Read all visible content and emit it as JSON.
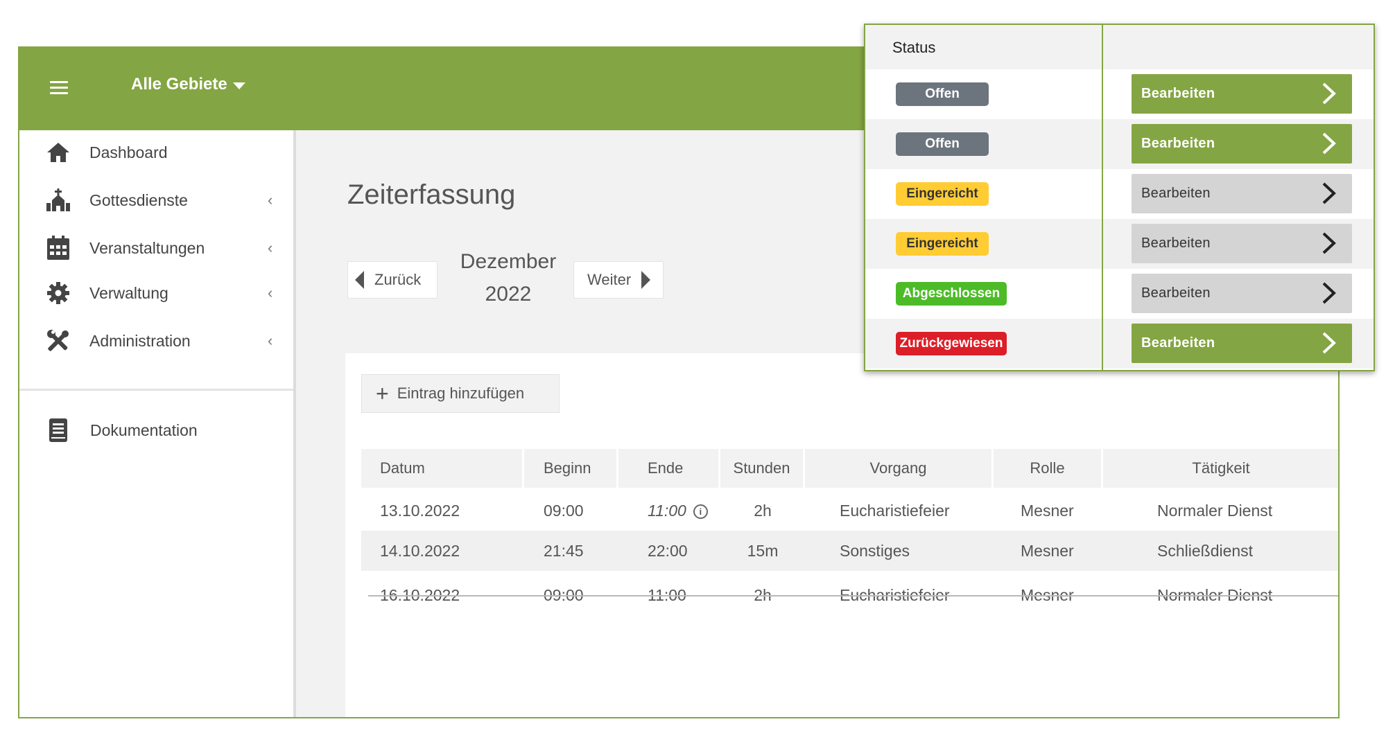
{
  "header": {
    "area_selector": "Alle Gebiete",
    "bg_color": "#84a543"
  },
  "sidebar": {
    "items": [
      {
        "label": "Dashboard",
        "icon": "home-icon",
        "has_submenu": false
      },
      {
        "label": "Gottesdienste",
        "icon": "church-icon",
        "has_submenu": true
      },
      {
        "label": "Veranstaltungen",
        "icon": "calendar-icon",
        "has_submenu": true
      },
      {
        "label": "Verwaltung",
        "icon": "gear-icon",
        "has_submenu": true
      },
      {
        "label": "Administration",
        "icon": "tools-icon",
        "has_submenu": true
      }
    ],
    "documentation": {
      "label": "Dokumentation",
      "icon": "book-icon"
    }
  },
  "main": {
    "title": "Zeiterfassung",
    "prev_label": "Zurück",
    "next_label": "Weiter",
    "month": "Dezember",
    "year": "2022",
    "add_entry_label": "Eintrag hinzufügen",
    "table": {
      "columns": [
        "Datum",
        "Beginn",
        "Ende",
        "Stunden",
        "Vorgang",
        "Rolle",
        "Tätigkeit"
      ],
      "rows": [
        {
          "datum": "13.10.2022",
          "beginn": "09:00",
          "ende": "11:00",
          "stunden": "2h",
          "vorgang": "Eucharistiefeier",
          "rolle": "Mesner",
          "taetigkeit": "Normaler Dienst"
        },
        {
          "datum": "14.10.2022",
          "beginn": "21:45",
          "ende": "22:00",
          "stunden": "15m",
          "vorgang": "Sonstiges",
          "rolle": "Mesner",
          "taetigkeit": "Schließdienst"
        },
        {
          "datum": "16.10.2022",
          "beginn": "09:00",
          "ende": "11:00",
          "stunden": "2h",
          "vorgang": "Eucharistiefeier",
          "rolle": "Mesner",
          "taetigkeit": "Normaler Dienst"
        }
      ]
    }
  },
  "status_popup": {
    "header": "Status",
    "edit_label": "Bearbeiten",
    "colors": {
      "offen": "#6c757d",
      "eingereicht": "#ffcc33",
      "abgeschlossen": "#4cbb27",
      "zurueckgewiesen": "#dc1e28",
      "button_active": "#84a543",
      "button_inactive": "#d4d4d4"
    },
    "rows": [
      {
        "status": "Offen",
        "kind": "offen",
        "button_active": true
      },
      {
        "status": "Offen",
        "kind": "offen",
        "button_active": true
      },
      {
        "status": "Eingereicht",
        "kind": "eingereicht",
        "button_active": false
      },
      {
        "status": "Eingereicht",
        "kind": "eingereicht",
        "button_active": false
      },
      {
        "status": "Abgeschlossen",
        "kind": "abgeschlossen",
        "button_active": false
      },
      {
        "status": "Zurückgewiesen",
        "kind": "zurueckgewiesen",
        "button_active": true
      }
    ]
  }
}
